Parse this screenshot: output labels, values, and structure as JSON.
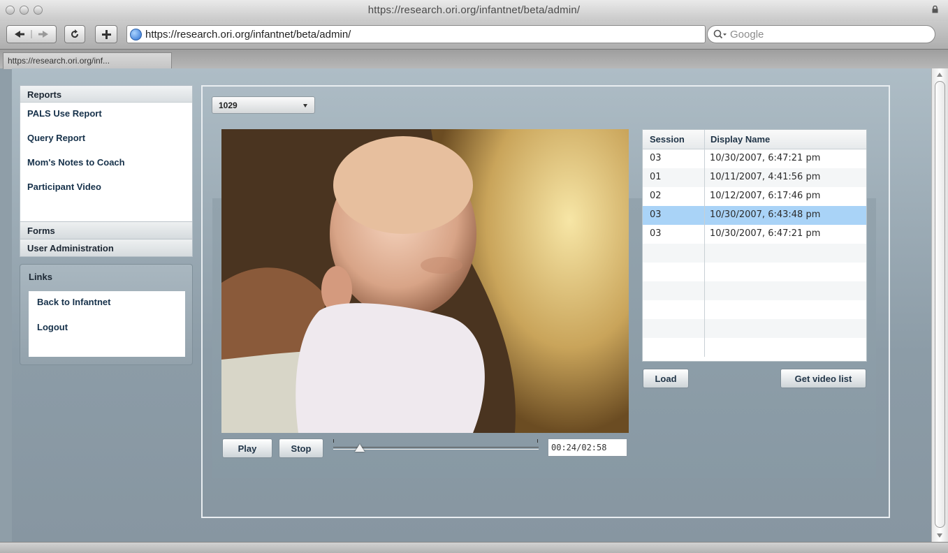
{
  "browser": {
    "window_title": "https://research.ori.org/infantnet/beta/admin/",
    "address": "https://research.ori.org/infantnet/beta/admin/",
    "search_placeholder": "Google",
    "tab_title": "https://research.ori.org/inf..."
  },
  "sidebar": {
    "reports_header": "Reports",
    "items": [
      "PALS Use Report",
      "Query Report",
      "Mom's Notes to Coach",
      "Participant Video"
    ],
    "forms_label": "Forms",
    "user_admin_label": "User Administration",
    "links_header": "Links",
    "links": [
      "Back to Infantnet",
      "Logout"
    ]
  },
  "main": {
    "participant_select": "1029",
    "play_label": "Play",
    "stop_label": "Stop",
    "time_display": "00:24/02:58",
    "playback_position": 0.13,
    "load_label": "Load",
    "get_video_list_label": "Get video list",
    "table": {
      "headers": [
        "Session",
        "Display Name"
      ],
      "rows": [
        {
          "session": "03",
          "display_name": "10/30/2007, 6:47:21 pm"
        },
        {
          "session": "01",
          "display_name": "10/11/2007, 4:41:56 pm"
        },
        {
          "session": "02",
          "display_name": "10/12/2007, 6:17:46 pm"
        },
        {
          "session": "03",
          "display_name": "10/30/2007, 6:43:48 pm"
        },
        {
          "session": "03",
          "display_name": "10/30/2007, 6:47:21 pm"
        }
      ],
      "selected_row": 3
    }
  },
  "colors": {
    "selection": "#a9d3f7",
    "panel_bg": "#8f9ea8"
  }
}
